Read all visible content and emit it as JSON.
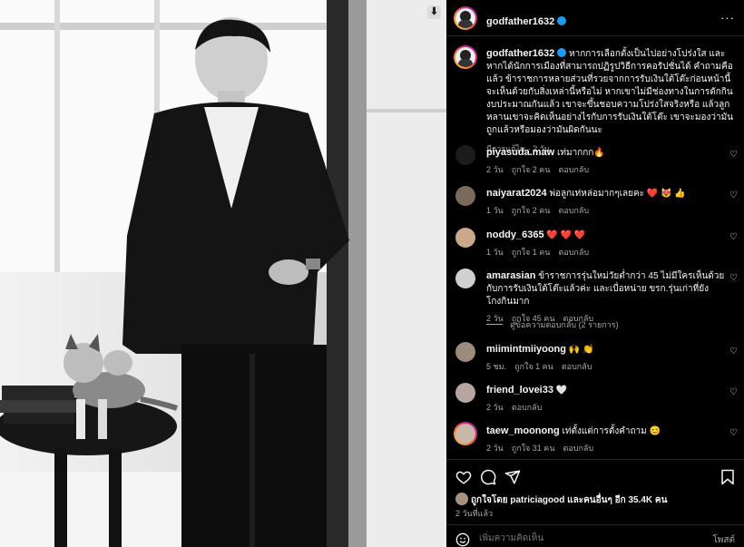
{
  "post": {
    "username": "godfather1632",
    "caption": "หากการเลือกตั้งเป็นไปอย่างโปร่งใส และหากได้นักการเมืองที่สามารถปฏิรูปวิธีการคอรัปชั่นได้ คำถามคือแล้ว ข้าราชการหลายส่วนที่รวยจากการรับเงินใต้โต๊ะก่อนหน้านี้จะเห็นด้วยกับสิ่งเหล่านี้หรือไม่ หากเขาไม่มีช่องทางในการดักกินงบประมาณกันแล้ว เขาจะขึ้นชอบความโปร่งใสจริงหรือ แล้วลูกหลานเขาจะคิดเห็นอย่างไรกับการรับเงินใต้โต๊ะ เขาจะมองว่ามันถูกแล้วหรือมองว่ามันผิดกันนะ",
    "edited": "มีการแก้ไข · 2 วัน",
    "likes_text": "ถูกใจโดย patriciagood และคนอื่นๆ อีก 35.4K คน",
    "liked_by_user": "patriciagood",
    "time_ago": "2 วันที่แล้ว",
    "add_comment_placeholder": "เพิ่มความคิดเห็น",
    "post_button": "โพสต์"
  },
  "comments": [
    {
      "user": "piyasuda.maw",
      "text": "เท่มากกก🔥",
      "time": "2 วัน",
      "likes": "ถูกใจ 2 คน",
      "reply": "ตอบกลับ"
    },
    {
      "user": "naiyarat2024",
      "text": "พ่อลูกเท่หล่อมากๆเลยคะ ❤️ 😻 👍",
      "time": "1 วัน",
      "likes": "ถูกใจ 2 คน",
      "reply": "ตอบกลับ"
    },
    {
      "user": "noddy_6365",
      "text": "❤️ ❤️ ❤️",
      "time": "1 วัน",
      "likes": "ถูกใจ 1 คน",
      "reply": "ตอบกลับ"
    },
    {
      "user": "amarasian",
      "text": "ข้าราชการรุ่นใหม่วัยต่ำกว่า 45 ไม่มีใครเห็นด้วยกับการรับเงินใต้โต๊ะแล้วค่ะ และเบื่อหน่าย ขรก.รุ่นเก่าที่ยังโกงกินมาก",
      "time": "2 วัน",
      "likes": "ถูกใจ 45 คน",
      "reply": "ตอบกลับ"
    },
    {
      "user": "miimintmiiyoong",
      "text": "🙌 👏",
      "time": "5 ชม.",
      "likes": "ถูกใจ 1 คน",
      "reply": "ตอบกลับ"
    },
    {
      "user": "friend_lovei33",
      "text": "🤍",
      "time": "2 วัน",
      "likes": "",
      "reply": "ตอบกลับ"
    },
    {
      "user": "taew_moonong",
      "text": "เท่ตั้งแต่การตั้งคำถาม 😊",
      "time": "2 วัน",
      "likes": "ถูกใจ 31 คน",
      "reply": "ตอบกลับ"
    }
  ],
  "view_replies": "ดูข้อความตอบกลับ (2 รายการ)"
}
